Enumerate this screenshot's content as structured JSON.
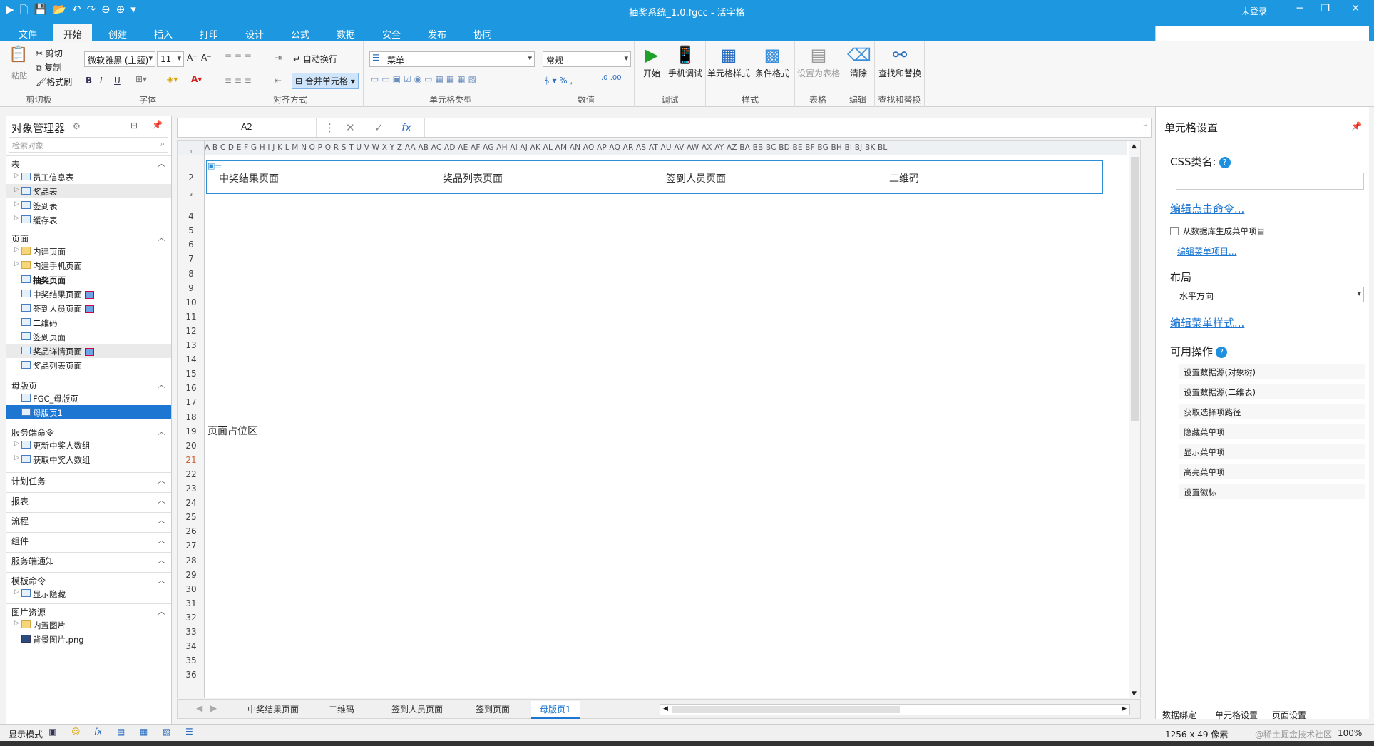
{
  "window": {
    "title": "抽奖系统_1.0.fgcc - 活字格",
    "login": "未登录"
  },
  "menubar": {
    "tabs": [
      "文件",
      "开始",
      "创建",
      "插入",
      "打印",
      "设计",
      "公式",
      "数据",
      "安全",
      "发布",
      "协同"
    ],
    "active": "开始"
  },
  "ribbon": {
    "clipboard": {
      "paste": "粘贴",
      "cut": "剪切",
      "copy": "复制",
      "format_painter": "格式刷",
      "label": "剪切板"
    },
    "font": {
      "name": "微软雅黑 (主题)",
      "size": "11",
      "label": "字体"
    },
    "align": {
      "wrap": "自动换行",
      "merge": "合并单元格",
      "label": "对齐方式"
    },
    "celltype": {
      "value": "菜单",
      "label": "单元格类型"
    },
    "number": {
      "value": "常规",
      "label": "数值"
    },
    "debug": {
      "start": "开始",
      "mobile": "手机调试",
      "label": "调试"
    },
    "style": {
      "cell_style": "单元格样式",
      "cond_format": "条件格式",
      "label": "样式"
    },
    "table": {
      "set_table": "设置为表格",
      "label": "表格"
    },
    "edit": {
      "clear": "清除",
      "label": "编辑"
    },
    "find": {
      "find_replace": "查找和替换",
      "label": "查找和替换"
    }
  },
  "formula_bar": {
    "namebox": "A2",
    "fx": "fx"
  },
  "object_manager": {
    "title": "对象管理器",
    "search_placeholder": "检索对象",
    "sections": {
      "table": {
        "label": "表",
        "items": [
          "员工信息表",
          "奖品表",
          "签到表",
          "缓存表"
        ]
      },
      "page": {
        "label": "页面",
        "items": [
          "内建页面",
          "内建手机页面",
          "抽奖页面",
          "中奖结果页面",
          "签到人员页面",
          "二维码",
          "签到页面",
          "奖品详情页面",
          "奖品列表页面"
        ]
      },
      "master": {
        "label": "母版页",
        "items": [
          "FGC_母版页",
          "母版页1"
        ]
      },
      "server_cmd": {
        "label": "服务端命令",
        "items": [
          "更新中奖人数组",
          "获取中奖人数组"
        ]
      },
      "schedule": {
        "label": "计划任务"
      },
      "report": {
        "label": "报表"
      },
      "flow": {
        "label": "流程"
      },
      "component": {
        "label": "组件"
      },
      "server_notify": {
        "label": "服务端通知"
      },
      "template_cmd": {
        "label": "模板命令",
        "items": [
          "显示隐藏"
        ]
      },
      "images": {
        "label": "图片资源",
        "items": [
          "内置图片",
          "背景图片.png"
        ]
      }
    }
  },
  "sheet": {
    "columns": "A B C D E F G H I J K L M N O P Q R S T U V W X Y Z AA AB AC AD AE AF AG AH AI AJ AK AL AM AN AO AP AQ AR AS AT AU AV AW AX AY AZ BA BB BC BD BE BF BG BH BI BJ BK BL",
    "rows": [
      "1",
      "2",
      "3",
      "4",
      "5",
      "6",
      "7",
      "8",
      "9",
      "10",
      "11",
      "12",
      "13",
      "14",
      "15",
      "16",
      "17",
      "18",
      "19",
      "20",
      "21",
      "22",
      "23",
      "24",
      "25",
      "26",
      "27",
      "28",
      "29",
      "30",
      "31",
      "32",
      "33",
      "34",
      "35",
      "36"
    ],
    "menu_items": [
      "中奖结果页面",
      "奖品列表页面",
      "签到人员页面",
      "二维码"
    ],
    "placeholder": "页面占位区"
  },
  "sheet_tabs": [
    "中奖结果页面",
    "二维码",
    "签到人员页面",
    "签到页面",
    "母版页1"
  ],
  "cell_settings": {
    "title": "单元格设置",
    "css_label": "CSS类名:",
    "edit_click": "编辑点击命令...",
    "from_db": "从数据库生成菜单项目",
    "edit_menu_items": "编辑菜单项目...",
    "layout_label": "布局",
    "layout_value": "水平方向",
    "edit_menu_style": "编辑菜单样式...",
    "ops_label": "可用操作",
    "ops": [
      "设置数据源(对象树)",
      "设置数据源(二维表)",
      "获取选择项路径",
      "隐藏菜单项",
      "显示菜单项",
      "高亮菜单项",
      "设置徽标"
    ],
    "tabs": [
      "数据绑定",
      "单元格设置",
      "页面设置"
    ]
  },
  "statusbar": {
    "mode": "显示模式",
    "size": "1256 x 49 像素",
    "zoom": "100%",
    "watermark": "@稀土掘金技术社区"
  }
}
